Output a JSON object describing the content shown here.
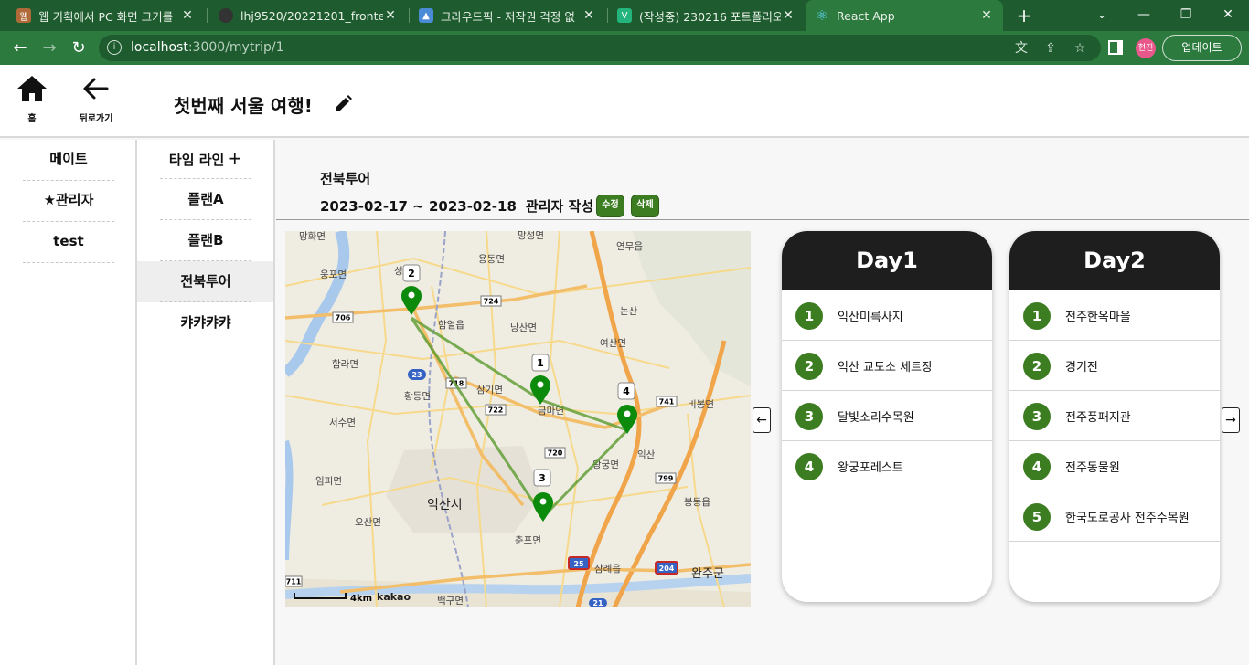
{
  "browser": {
    "tabs": [
      {
        "title": "웹 기획에서 PC 화면 크기를",
        "color": "#b06a3a",
        "glyph": "웹"
      },
      {
        "title": "lhj9520/20221201_frontend",
        "color": "#333333",
        "glyph": "●"
      },
      {
        "title": "크라우드픽 - 저작권 걱정 없",
        "color": "#4a8bd6",
        "glyph": "▲"
      },
      {
        "title": "(작성중) 230216 포트폴리오",
        "color": "#24b47e",
        "glyph": "V"
      },
      {
        "title": "React App",
        "color": "#61dafb",
        "glyph": "⚛"
      }
    ],
    "url_host": "localhost",
    "url_path": ":3000/mytrip/1",
    "profile_label": "현진",
    "update_label": "업데이트"
  },
  "header": {
    "home_label": "홈",
    "back_label": "뒤로가기",
    "trip_title": "첫번째 서울 여행!"
  },
  "mates": {
    "title": "메이트",
    "items": [
      "★관리자",
      "test"
    ]
  },
  "timeline": {
    "title": "타임 라인",
    "add_icon": "+",
    "plans": [
      "플랜A",
      "플랜B",
      "전북투어",
      "캬캬캬캬"
    ],
    "selected_index": 2
  },
  "plan": {
    "name": "전북투어",
    "date_range": "2023-02-17 ~ 2023-02-18",
    "author": "관리자 작성",
    "edit_label": "수정",
    "delete_label": "삭제"
  },
  "map": {
    "scale_label": "4km",
    "brand": "kakao",
    "markers": [
      "1",
      "2",
      "3",
      "4"
    ],
    "places": [
      "망화면",
      "용동면",
      "망성면",
      "연무읍",
      "논산",
      "웅포면",
      "성당면",
      "함열읍",
      "낭산면",
      "여산면",
      "함라면",
      "황등면",
      "삼기면",
      "금마면",
      "비봉면",
      "서수면",
      "임피면",
      "익산시",
      "왕궁면",
      "오산면",
      "춘포면",
      "봉동읍",
      "삼례읍",
      "완주군",
      "백구면",
      "익산"
    ],
    "route_labels": [
      "706",
      "724",
      "23",
      "718",
      "722",
      "720",
      "741",
      "799",
      "25",
      "204",
      "21",
      "711"
    ]
  },
  "days": [
    {
      "title": "Day1",
      "items": [
        "익산미륵사지",
        "익산 교도소 세트장",
        "달빛소리수목원",
        "왕궁포레스트"
      ]
    },
    {
      "title": "Day2",
      "items": [
        "전주한옥마을",
        "경기전",
        "전주풍패지관",
        "전주동물원",
        "한국도로공사 전주수목원"
      ]
    }
  ],
  "nav": {
    "prev_icon": "←",
    "next_icon": "→"
  },
  "colors": {
    "browser_dark": "#1e5c2f",
    "browser_light": "#2d7a3f",
    "accent_green": "#3c7d22",
    "marker_green": "#0b8a0b",
    "day_header": "#1e1e1e"
  }
}
